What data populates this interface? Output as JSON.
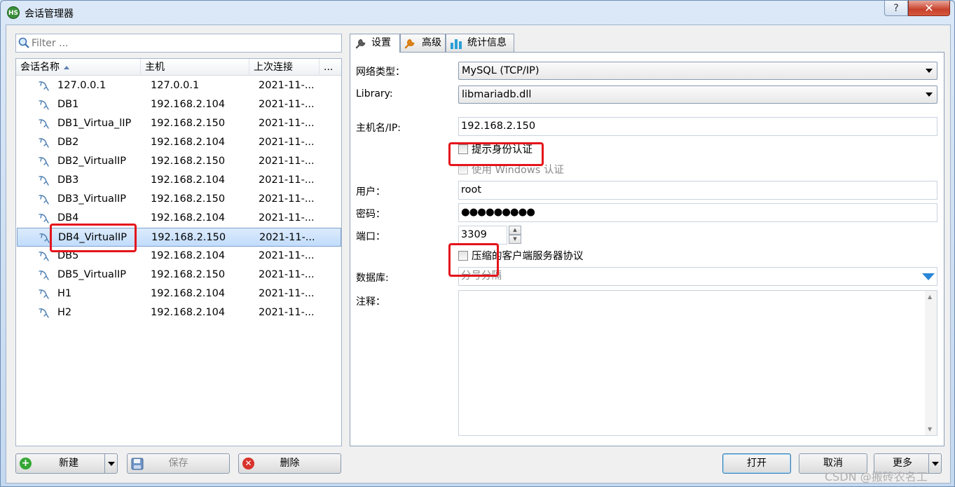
{
  "window": {
    "title": "会话管理器",
    "app_icon": "HS",
    "help": "?",
    "close": "✕"
  },
  "filter": {
    "placeholder": "Filter ..."
  },
  "columns": [
    "会话名称",
    "主机",
    "上次连接",
    "..."
  ],
  "sessions": [
    {
      "name": "127.0.0.1",
      "host": "127.0.0.1",
      "last": "2021-11-..."
    },
    {
      "name": "DB1",
      "host": "192.168.2.104",
      "last": "2021-11-..."
    },
    {
      "name": "DB1_Virtua_lIP",
      "host": "192.168.2.150",
      "last": "2021-11-..."
    },
    {
      "name": "DB2",
      "host": "192.168.2.104",
      "last": "2021-11-..."
    },
    {
      "name": "DB2_VirtualIP",
      "host": "192.168.2.150",
      "last": "2021-11-..."
    },
    {
      "name": "DB3",
      "host": "192.168.2.104",
      "last": "2021-11-..."
    },
    {
      "name": "DB3_VirtualIP",
      "host": "192.168.2.150",
      "last": "2021-11-..."
    },
    {
      "name": "DB4",
      "host": "192.168.2.104",
      "last": "2021-11-..."
    },
    {
      "name": "DB4_VirtualIP",
      "host": "192.168.2.150",
      "last": "2021-11-..."
    },
    {
      "name": "DB5",
      "host": "192.168.2.104",
      "last": "2021-11-..."
    },
    {
      "name": "DB5_VirtualIP",
      "host": "192.168.2.150",
      "last": "2021-11-..."
    },
    {
      "name": "H1",
      "host": "192.168.2.104",
      "last": "2021-11-..."
    },
    {
      "name": "H2",
      "host": "192.168.2.104",
      "last": "2021-11-..."
    }
  ],
  "selected_session": "DB4_VirtualIP",
  "left_buttons": {
    "new": "新建",
    "save": "保存",
    "delete": "删除"
  },
  "tabs": [
    {
      "label": "设置",
      "icon": "wrench-icon"
    },
    {
      "label": "高级",
      "icon": "wrench-orange-icon"
    },
    {
      "label": "统计信息",
      "icon": "bar-chart-icon"
    }
  ],
  "settings": {
    "network_type_label": "网络类型：",
    "network_type_value": "MySQL (TCP/IP)",
    "library_label": "Library:",
    "library_value": "libmariadb.dll",
    "host_label": "主机名/IP:",
    "host_value": "192.168.2.150",
    "prompt_auth": "提示身份认证",
    "windows_auth": "使用 Windows 认证",
    "user_label": "用户：",
    "user_value": "root",
    "password_label": "密码：",
    "password_value": "●●●●●●●●●",
    "port_label": "端口：",
    "port_value": "3309",
    "compress": "压缩的客户端服务器协议",
    "database_label": "数据库:",
    "database_placeholder": "分号分隔",
    "comment_label": "注释："
  },
  "bottom_buttons": {
    "open": "打开",
    "cancel": "取消",
    "more": "更多"
  },
  "watermark": "CSDN @搬砖农名工",
  "colors": {
    "highlight_red": "#e4141b",
    "selection_blue": "#c1dcfc",
    "new_green": "#35a635",
    "delete_red": "#d8322b"
  }
}
